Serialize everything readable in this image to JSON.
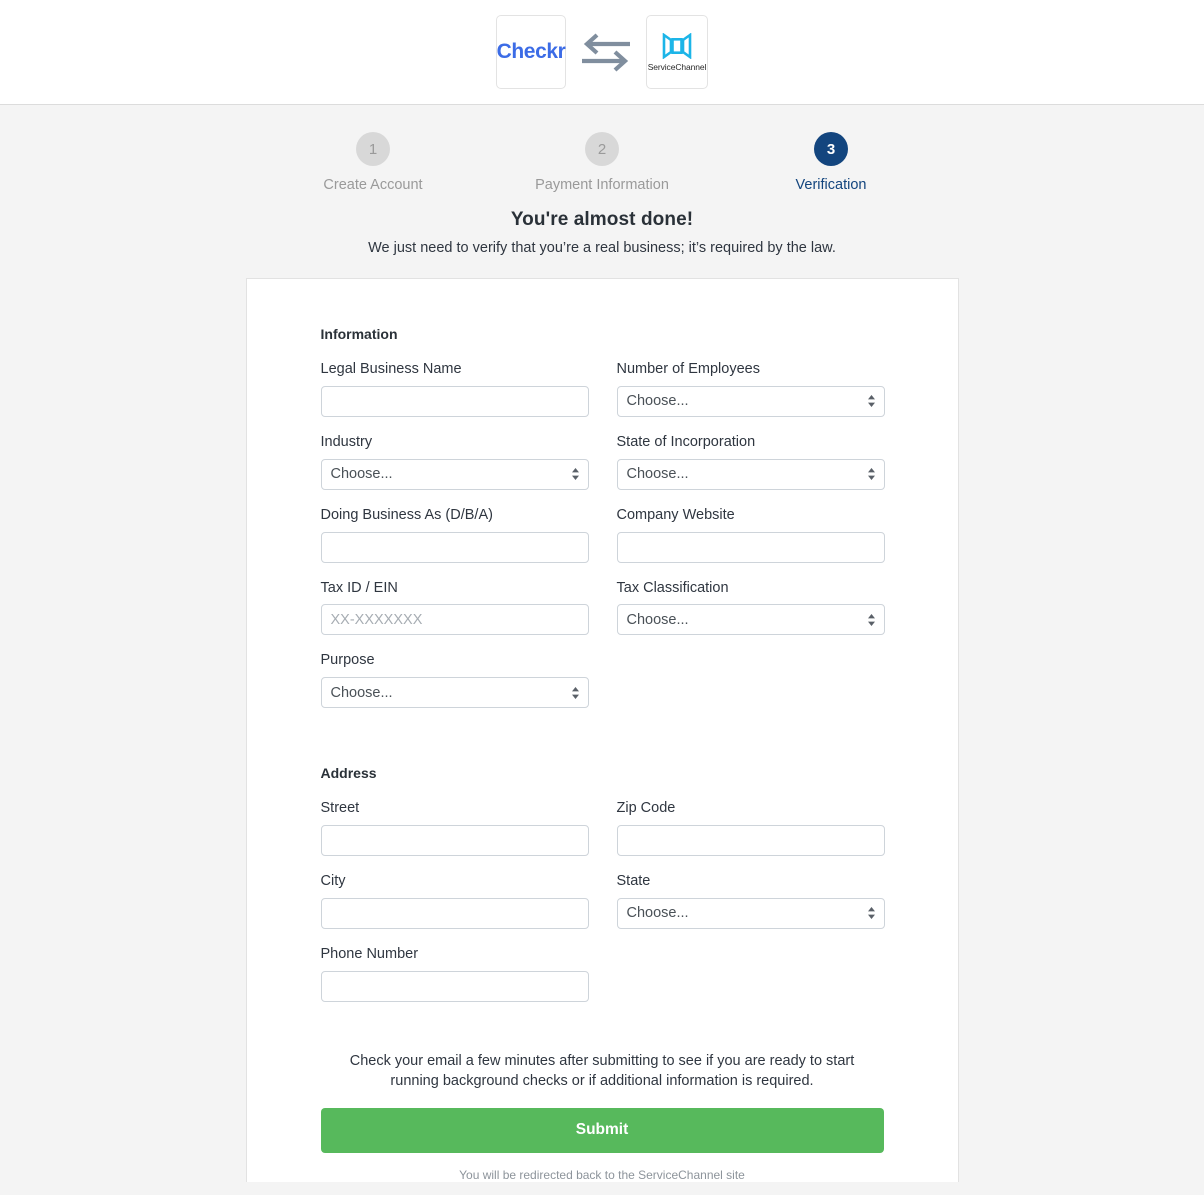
{
  "header": {
    "checkr_logo_text": "Checkr",
    "swap_icon": "swap-arrows-icon",
    "servicechannel_logo_text": "ServiceChannel"
  },
  "stepper": {
    "steps": [
      {
        "number": "1",
        "label": "Create Account",
        "active": false
      },
      {
        "number": "2",
        "label": "Payment Information",
        "active": false
      },
      {
        "number": "3",
        "label": "Verification",
        "active": true
      }
    ]
  },
  "intro": {
    "title": "You're almost done!",
    "subtitle": "We just need to verify that you’re a real business; it’s required by the law."
  },
  "form": {
    "information_section_title": "Information",
    "address_section_title": "Address",
    "fields": {
      "legal_business_name": {
        "label": "Legal Business Name",
        "value": "",
        "placeholder": ""
      },
      "number_of_employees": {
        "label": "Number of Employees",
        "value": "Choose..."
      },
      "industry": {
        "label": "Industry",
        "value": "Choose..."
      },
      "state_of_incorporation": {
        "label": "State of Incorporation",
        "value": "Choose..."
      },
      "dba": {
        "label": "Doing Business As (D/B/A)",
        "value": "",
        "placeholder": ""
      },
      "company_website": {
        "label": "Company Website",
        "value": "",
        "placeholder": ""
      },
      "tax_id": {
        "label": "Tax ID / EIN",
        "value": "",
        "placeholder": "XX-XXXXXXX"
      },
      "tax_classification": {
        "label": "Tax Classification",
        "value": "Choose..."
      },
      "purpose": {
        "label": "Purpose",
        "value": "Choose..."
      },
      "street": {
        "label": "Street",
        "value": "",
        "placeholder": ""
      },
      "zip_code": {
        "label": "Zip Code",
        "value": "",
        "placeholder": ""
      },
      "city": {
        "label": "City",
        "value": "",
        "placeholder": ""
      },
      "state": {
        "label": "State",
        "value": "Choose..."
      },
      "phone_number": {
        "label": "Phone Number",
        "value": "",
        "placeholder": ""
      }
    }
  },
  "footer": {
    "note": "Check your email a few minutes after submitting to see if you are ready to start running background checks or if additional information is required.",
    "submit_label": "Submit",
    "redirect_note": "You will be redirected back to the ServiceChannel site"
  },
  "colors": {
    "active_step": "#13457e",
    "inactive_step": "#d8d8d8",
    "submit_green": "#57b95c",
    "checkr_blue": "#3c6ce6",
    "servicechannel_cyan": "#1cb5e8",
    "page_bg": "#f4f4f4"
  }
}
